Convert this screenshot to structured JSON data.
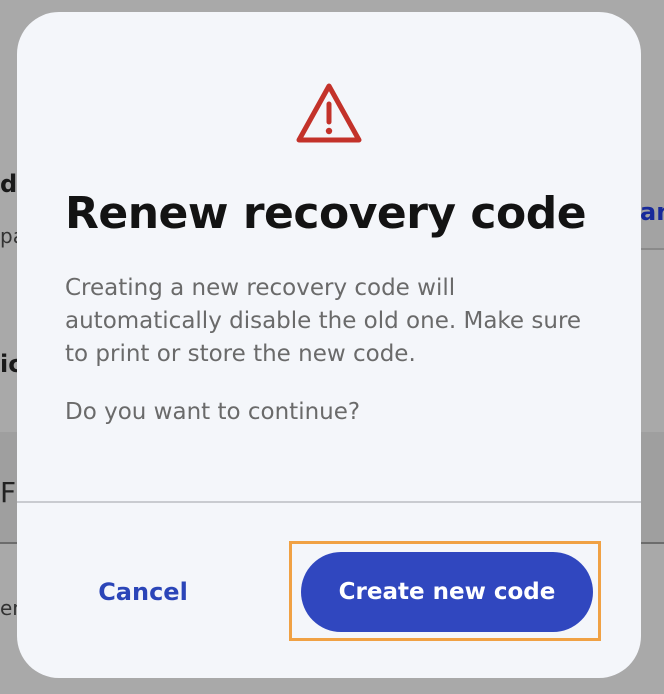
{
  "background": {
    "fragments": [
      "d",
      "pa",
      "ic",
      "F",
      "en",
      "an"
    ]
  },
  "dialog": {
    "icon": "warning-triangle-icon",
    "title": "Renew recovery code",
    "body": "Creating a new recovery code will automatically disable the old one. Make sure to print or store the new code.",
    "question": "Do you want to continue?",
    "cancel_label": "Cancel",
    "confirm_label": "Create new code"
  },
  "colors": {
    "overlay": "#a9a9a9",
    "dialog_bg": "#f4f6fa",
    "warning": "#c3322a",
    "primary": "#3047bf",
    "link": "#2b45b8",
    "highlight": "#f0a144"
  }
}
